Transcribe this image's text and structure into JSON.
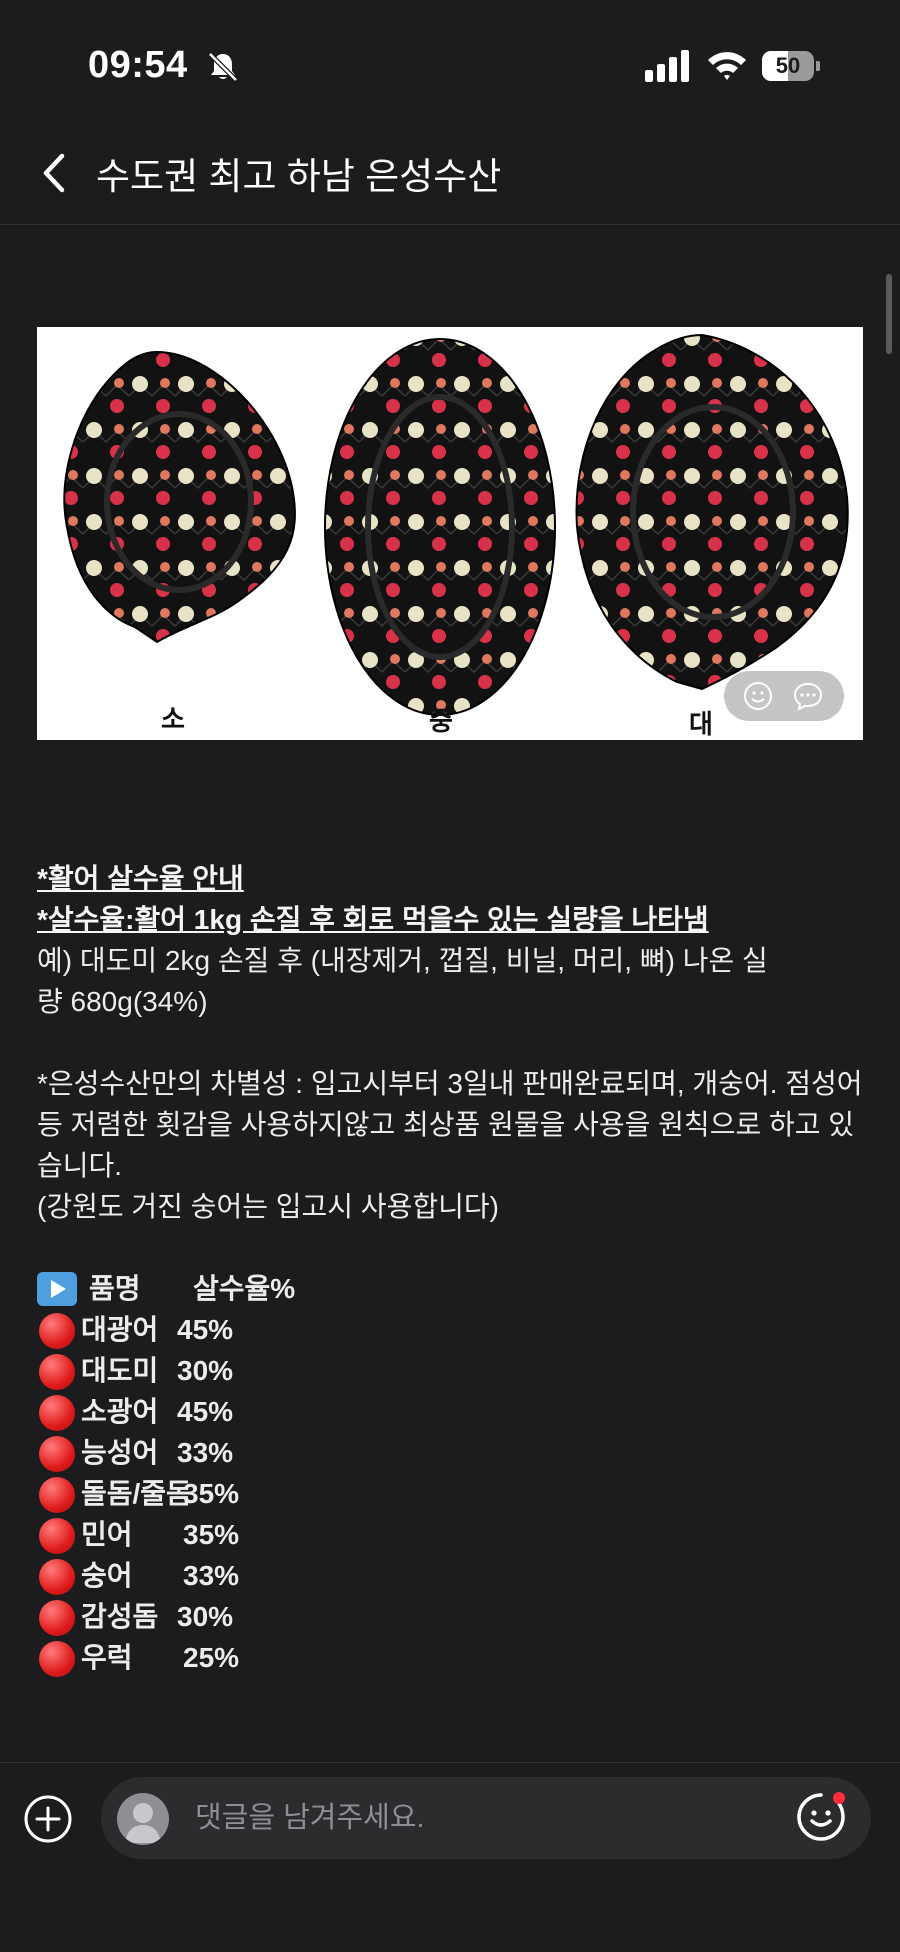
{
  "status_bar": {
    "time": "09:54",
    "battery": "50",
    "battery_level": 0.5
  },
  "header": {
    "title": "수도권 최고 하남 은성수산"
  },
  "photo": {
    "labels": [
      "소",
      "중",
      "대"
    ]
  },
  "post": {
    "heading": "*활어 살수율 안내",
    "subheading": "*살수율:활어 1kg 손질 후 회로 먹을수 있는 실량을 나타냄",
    "example_line1": "예) 대도미 2kg 손질 후 (내장제거, 껍질, 비닐, 머리, 뼈) 나온 실",
    "example_line2": "량 680g(34%)",
    "diff_text": "*은성수산만의 차별성 : 입고시부터 3일내 판매완료되며, 개숭어. 점성어등 저렴한 횟감을 사용하지않고 최상품 원물을 사용을 원칙으로 하고 있습니다.",
    "note": "(강원도 거진 숭어는 입고시 사용합니다)",
    "table_header": {
      "name": "품명",
      "rate": "살수율%"
    },
    "table": [
      {
        "name": "대광어",
        "rate": "45%"
      },
      {
        "name": "대도미",
        "rate": "30%"
      },
      {
        "name": "소광어",
        "rate": "45%"
      },
      {
        "name": "능성어",
        "rate": "33%"
      },
      {
        "name": "돌돔/줄돔",
        "rate": "35%"
      },
      {
        "name": "민어",
        "rate": "35%"
      },
      {
        "name": "숭어",
        "rate": "33%"
      },
      {
        "name": "감성돔",
        "rate": "30%"
      },
      {
        "name": "우럭",
        "rate": "25%"
      }
    ]
  },
  "comment": {
    "placeholder": "댓글을 남겨주세요."
  }
}
